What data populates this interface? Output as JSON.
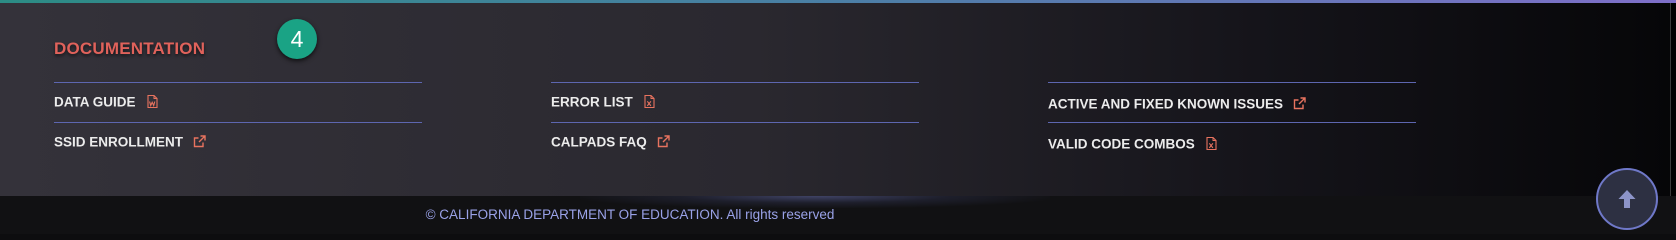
{
  "documentation": {
    "title": "DOCUMENTATION",
    "step_badge": "4",
    "columns": [
      {
        "links": [
          {
            "label": "DATA GUIDE",
            "icon": "word-document-icon"
          },
          {
            "label": "SSID ENROLLMENT",
            "icon": "external-link-icon"
          }
        ]
      },
      {
        "links": [
          {
            "label": "ERROR LIST",
            "icon": "excel-document-icon"
          },
          {
            "label": "CALPADS FAQ",
            "icon": "external-link-icon"
          }
        ]
      },
      {
        "links": [
          {
            "label": "ACTIVE AND FIXED KNOWN ISSUES",
            "icon": "external-link-icon"
          },
          {
            "label": "VALID CODE COMBOS",
            "icon": "excel-document-icon"
          }
        ]
      }
    ]
  },
  "footer": {
    "copyright": "© CALIFORNIA DEPARTMENT OF EDUCATION. All rights reserved"
  },
  "scroll_to_top": {
    "icon": "arrow-up-icon"
  },
  "colors": {
    "title": "#e0625b",
    "badge": "#1aa385",
    "divider": "#5d66b0",
    "icon_accent": "#e8735f",
    "copyright": "#9aa2e8"
  }
}
